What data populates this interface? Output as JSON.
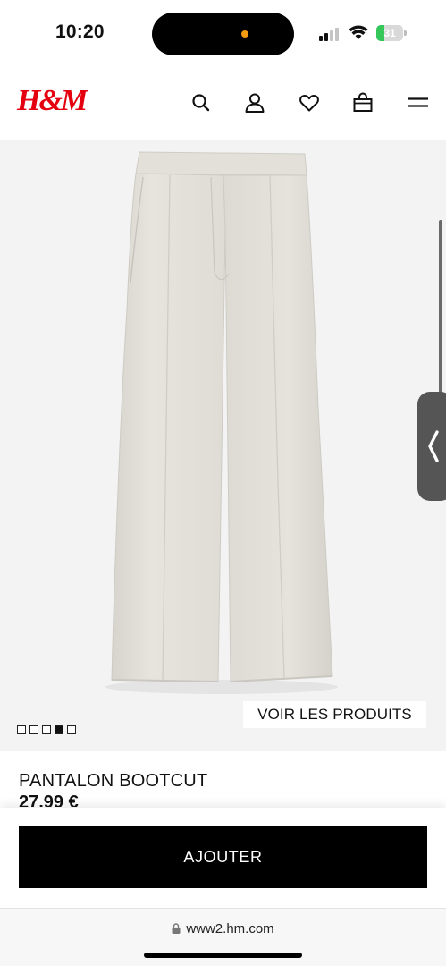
{
  "status_bar": {
    "time": "10:20",
    "battery_level": "31",
    "battery_fraction": 0.31,
    "signal_bars_active": 2,
    "signal_bars_total": 4,
    "battery_color": "#35c759",
    "camera_indicator_color": "#f39a12"
  },
  "header": {
    "logo": "H&M",
    "brand_color": "#e50010",
    "icons": [
      "search-icon",
      "account-icon",
      "favorites-heart-icon",
      "shopping-bag-icon",
      "menu-hamburger-icon"
    ]
  },
  "gallery": {
    "image_count": 5,
    "active_index": 3,
    "voir_button_label": "VOIR LES PRODUITS",
    "background_color": "#f3f3f3"
  },
  "product": {
    "name": "PANTALON BOOTCUT",
    "price": "27,99 €"
  },
  "cta": {
    "add_label": "AJOUTER"
  },
  "browser": {
    "url": "www2.hm.com"
  }
}
